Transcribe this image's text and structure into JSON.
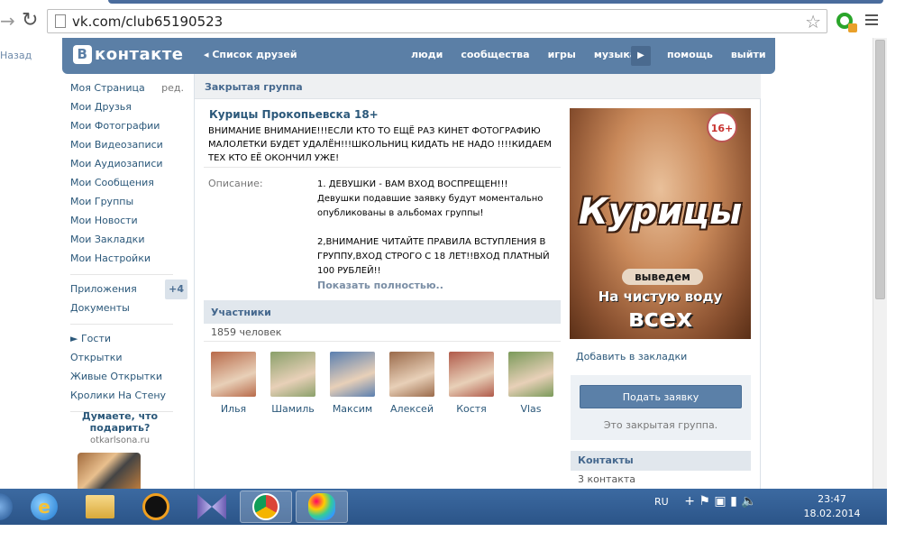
{
  "browser": {
    "url": "vk.com/club65190523",
    "back_label": "Назад"
  },
  "header": {
    "logo": "контакте",
    "logo_badge": "В",
    "friends_list": "Список друзей",
    "nav": [
      "люди",
      "сообщества",
      "игры",
      "музыка"
    ],
    "nav_right": [
      "помощь",
      "выйти"
    ]
  },
  "sidebar": {
    "items": [
      {
        "label": "Моя Страница",
        "edit": "ред."
      },
      {
        "label": "Мои Друзья"
      },
      {
        "label": "Мои Фотографии"
      },
      {
        "label": "Мои Видеозаписи"
      },
      {
        "label": "Мои Аудиозаписи"
      },
      {
        "label": "Мои Сообщения"
      },
      {
        "label": "Мои Группы"
      },
      {
        "label": "Мои Новости"
      },
      {
        "label": "Мои Закладки"
      },
      {
        "label": "Мои Настройки"
      }
    ],
    "apps_label": "Приложения",
    "apps_badge": "+4",
    "docs_label": "Документы",
    "extra": [
      "► Гости",
      "Открытки",
      "Живые Открытки",
      "Кролики На Стену"
    ],
    "ad_question": "Думаете, что подарить?",
    "ad_site": "otkarlsona.ru"
  },
  "group": {
    "bar_title": "Закрытая группа",
    "name": "Курицы Прокопьевска 18+",
    "status": "ВНИМАНИЕ ВНИМАНИЕ!!!ЕСЛИ КТО ТО ЕЩЁ РАЗ КИНЕТ ФОТОГРАФИЮ МАЛОЛЕТКИ БУДЕТ УДАЛЁН!!!ШКОЛЬНИЦ КИДАТЬ НЕ НАДО !!!!КИДАЕМ ТЕХ КТО ЕЁ ОКОНЧИЛ УЖЕ!",
    "desc_label": "Описание:",
    "desc_lines": [
      "1. ДЕВУШКИ - ВАМ ВХОД ВОСПРЕЩЕН!!!",
      "Девушки подавшие заявку будут моментально",
      "опубликованы в альбомах группы!",
      "",
      "2,ВНИМАНИЕ ЧИТАЙТЕ ПРАВИЛА ВСТУПЛЕНИЯ В",
      "ГРУППУ,ВХОД СТРОГО С 18 ЛЕТ!!ВХОД ПЛАТНЫЙ",
      "100 РУБЛЕЙ!!"
    ],
    "more": "Показать полностью..",
    "members_title": "Участники",
    "members_count": "1859 человек",
    "members": [
      {
        "name": "Илья",
        "color": "#b86a4a"
      },
      {
        "name": "Шамиль",
        "color": "#8aa06a"
      },
      {
        "name": "Максим",
        "color": "#5a7fb0"
      },
      {
        "name": "Алексей",
        "color": "#9a6a4a"
      },
      {
        "name": "Костя",
        "color": "#b05a4a"
      },
      {
        "name": "Vlas",
        "color": "#7a9a5a"
      }
    ]
  },
  "right": {
    "poster_age": "16+",
    "poster_title": "Курицы",
    "poster_sub1": "выведем",
    "poster_sub2": "На чистую воду",
    "poster_sub3": "всех",
    "bookmark": "Добавить в закладки",
    "join_button": "Подать заявку",
    "closed_note": "Это закрытая группа.",
    "contacts_title": "Контакты",
    "contacts_count": "3 контакта"
  },
  "taskbar": {
    "lang": "RU",
    "time": "23:47",
    "date": "18.02.2014"
  }
}
